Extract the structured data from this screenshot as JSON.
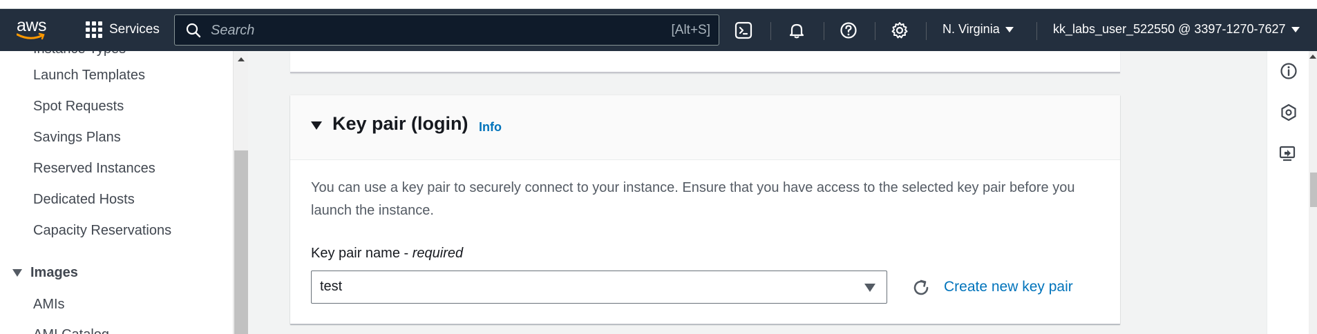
{
  "navbar": {
    "logo_text": "aws",
    "services_label": "Services",
    "search_placeholder": "Search",
    "search_shortcut": "[Alt+S]",
    "region": "N. Virginia",
    "account": "kk_labs_user_522550 @ 3397-1270-7627",
    "icons": [
      "cloudshell-icon",
      "bell-icon",
      "help-icon",
      "settings-icon"
    ]
  },
  "sidebar": {
    "items": [
      {
        "label": "Launch Templates"
      },
      {
        "label": "Spot Requests"
      },
      {
        "label": "Savings Plans"
      },
      {
        "label": "Reserved Instances"
      },
      {
        "label": "Dedicated Hosts"
      },
      {
        "label": "Capacity Reservations"
      }
    ],
    "section_images": "Images",
    "images_items": [
      {
        "label": "AMIs"
      },
      {
        "label": "AMI Catalog"
      }
    ]
  },
  "key_pair": {
    "title": "Key pair (login)",
    "info": "Info",
    "description": "You can use a key pair to securely connect to your instance. Ensure that you have access to the selected key pair before you launch the instance.",
    "field_label": "Key pair name - ",
    "field_required": "required",
    "selected_value": "test",
    "create_link": "Create new key pair"
  },
  "right_rail": {
    "icons": [
      "info-icon",
      "hexagon-icon",
      "feedback-icon"
    ]
  },
  "colors": {
    "navbar_bg": "#232f3e",
    "link": "#0073bb",
    "text": "#16191f",
    "secondary_text": "#545b64"
  }
}
